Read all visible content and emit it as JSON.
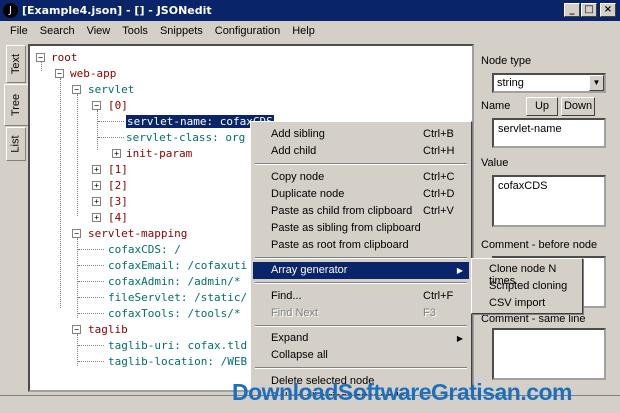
{
  "window": {
    "title": "[Example4.json] - [] - JSONedit"
  },
  "menu": [
    "File",
    "Search",
    "View",
    "Tools",
    "Snippets",
    "Configuration",
    "Help"
  ],
  "side_tabs": [
    "Text",
    "Tree",
    "List"
  ],
  "tree": {
    "root": "root",
    "web_app": "web-app",
    "servlet": "servlet",
    "idx0": "[0]",
    "servlet_name": "servlet-name: cofaxCDS",
    "servlet_class": "servlet-class: org",
    "init_param": "init-param",
    "idx1": "[1]",
    "idx2": "[2]",
    "idx3": "[3]",
    "idx4": "[4]",
    "servlet_mapping": "servlet-mapping",
    "m_cds": "cofaxCDS: /",
    "m_email": "cofaxEmail: /cofaxuti",
    "m_admin": "cofaxAdmin: /admin/*",
    "m_file": "fileServlet: /static/",
    "m_tools": "cofaxTools: /tools/*",
    "taglib": "taglib",
    "taglib_uri": "taglib-uri: cofax.tld",
    "taglib_location": "taglib-location: /WEB"
  },
  "panel": {
    "node_type_label": "Node type",
    "node_type_value": "string",
    "name_label": "Name",
    "up_button": "Up",
    "down_button": "Down",
    "name_value": "servlet-name",
    "value_label": "Value",
    "value_value": "cofaxCDS",
    "comment_before_label": "Comment - before node",
    "comment_same_label": "Comment - same line"
  },
  "context_menu": {
    "add_sibling": {
      "label": "Add sibling",
      "shortcut": "Ctrl+B"
    },
    "add_child": {
      "label": "Add child",
      "shortcut": "Ctrl+H"
    },
    "copy_node": {
      "label": "Copy node",
      "shortcut": "Ctrl+C"
    },
    "duplicate_node": {
      "label": "Duplicate node",
      "shortcut": "Ctrl+D"
    },
    "paste_child": {
      "label": "Paste as child from clipboard",
      "shortcut": "Ctrl+V"
    },
    "paste_sibling": {
      "label": "Paste as sibling from clipboard",
      "shortcut": ""
    },
    "paste_root": {
      "label": "Paste as root from clipboard",
      "shortcut": ""
    },
    "array_generator": {
      "label": "Array generator",
      "shortcut": ""
    },
    "find": {
      "label": "Find...",
      "shortcut": "Ctrl+F"
    },
    "find_next": {
      "label": "Find Next",
      "shortcut": "F3"
    },
    "expand": {
      "label": "Expand",
      "shortcut": ""
    },
    "collapse_all": {
      "label": "Collapse all",
      "shortcut": ""
    },
    "delete_selected": {
      "label": "Delete selected node",
      "shortcut": ""
    },
    "delete_all_strings": {
      "label": "Delete all strings after node",
      "shortcut": ""
    }
  },
  "submenu": [
    "Clone node N times",
    "Scripted cloning",
    "CSV import"
  ],
  "watermark": "DownloadSoftwareGratisan.com",
  "colors": {
    "titlebar": "#0a246a",
    "selection": "#0a246a",
    "tree_key": "#8b0000",
    "tree_leaf": "#007070",
    "watermark": "#1d6fbe"
  }
}
